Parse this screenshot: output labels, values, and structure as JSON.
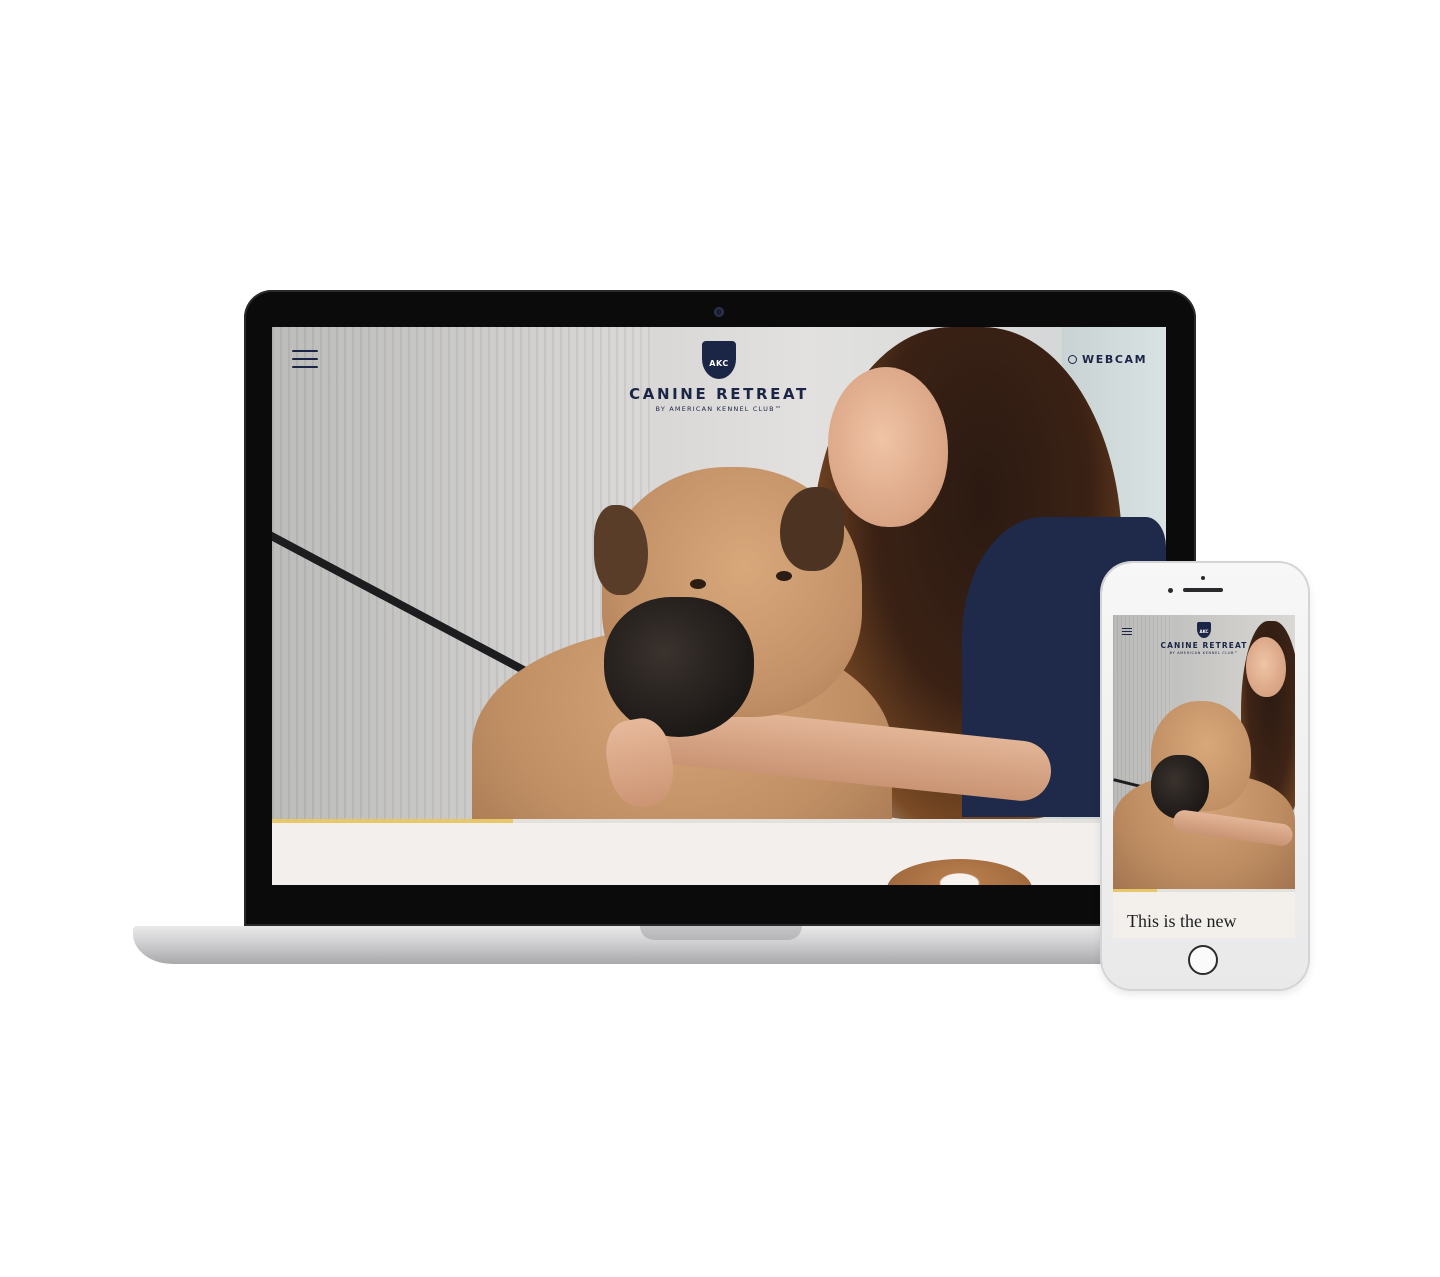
{
  "site": {
    "brand_name": "CANINE RETREAT",
    "brand_sub": "BY AMERICAN KENNEL CLUB™",
    "shield_text": "AKC",
    "webcam_label": "WEBCAM",
    "menu_icon": "hamburger-menu-icon",
    "webcam_icon": "webcam-icon",
    "brand_color": "#1b2545",
    "accent_color": "#e8c76a",
    "progress": 0.27
  },
  "mobile": {
    "brand_name": "CANINE RETREAT",
    "brand_sub": "BY AMERICAN KENNEL CLUB™",
    "shield_text": "AKC",
    "headline": "This is the new",
    "progress": 0.24
  }
}
